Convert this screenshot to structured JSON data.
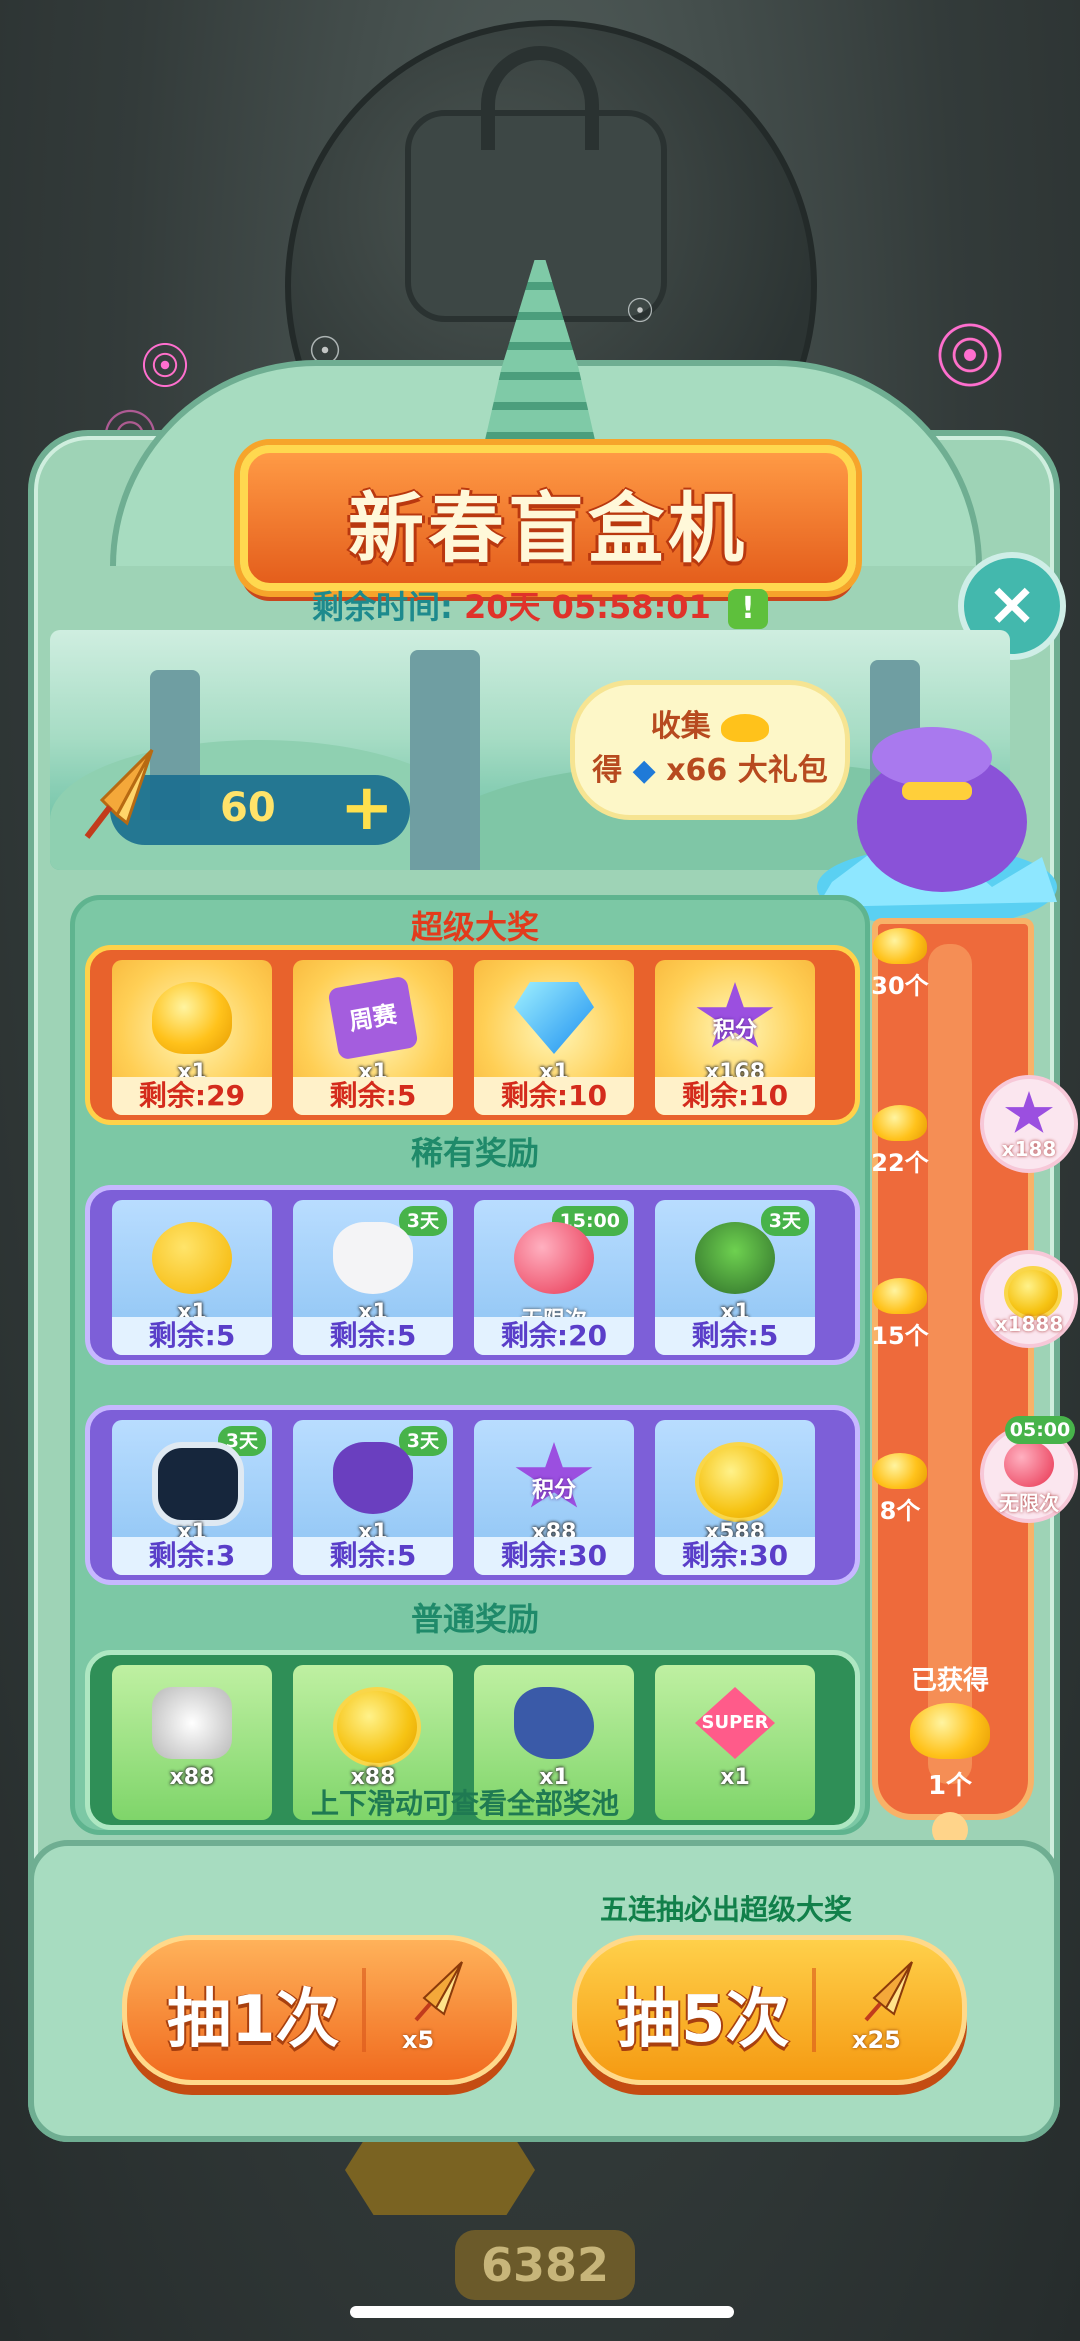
{
  "title": "新春盲盒机",
  "timer": {
    "label": "剩余时间:",
    "value": "20天 05:58:01",
    "alert_icon": "!"
  },
  "tokens": {
    "count": "60",
    "plus": "+"
  },
  "collect": {
    "line1": "收集",
    "line2_prefix": "得",
    "line2_value": "x66",
    "line2_suffix": "大礼包"
  },
  "close_icon": "×",
  "sections": {
    "super": "超级大奖",
    "rare": "稀有奖励",
    "normal": "普通奖励"
  },
  "super_row": [
    {
      "icon": "gold-ingot-icon",
      "qty": "x1",
      "remain": "剩余:29"
    },
    {
      "icon": "weekly-match-ticket-icon",
      "qty": "x1",
      "remain": "剩余:5",
      "label": "周赛"
    },
    {
      "icon": "diamond-icon",
      "qty": "x1",
      "remain": "剩余:10"
    },
    {
      "icon": "score-star-icon",
      "qty": "x168",
      "remain": "剩余:10",
      "label": "积分"
    }
  ],
  "rare_row1": [
    {
      "icon": "golden-egg-icon",
      "qty": "x1",
      "remain": "剩余:5"
    },
    {
      "icon": "rabbit-mask-icon",
      "qty": "x1",
      "remain": "剩余:5",
      "tag": "3天"
    },
    {
      "icon": "balloon-icon",
      "note": "无限次",
      "remain": "剩余:20",
      "tag": "15:00"
    },
    {
      "icon": "frog-mask-icon",
      "qty": "x1",
      "remain": "剩余:5",
      "tag": "3天"
    }
  ],
  "rare_row2": [
    {
      "icon": "goggles-icon",
      "qty": "x1",
      "remain": "剩余:3",
      "tag": "3天"
    },
    {
      "icon": "cat-helmet-icon",
      "qty": "x1",
      "remain": "剩余:5",
      "tag": "3天"
    },
    {
      "icon": "score-star-icon",
      "qty": "x88",
      "remain": "剩余:30",
      "label": "积分"
    },
    {
      "icon": "coin-icon",
      "qty": "x588",
      "remain": "剩余:30"
    }
  ],
  "normal_row": [
    {
      "icon": "silver-badge-icon",
      "qty": "x88"
    },
    {
      "icon": "coin-icon",
      "qty": "x88"
    },
    {
      "icon": "shark-icon",
      "qty": "x1"
    },
    {
      "icon": "super-badge-icon",
      "qty": "x1",
      "label": "SUPER"
    }
  ],
  "scroll_hint": "上下滑动可查看全部奖池",
  "progress": {
    "milestones": [
      "30个",
      "22个",
      "15个",
      "8个"
    ],
    "rewards": [
      {
        "icon": "score-star-icon",
        "qty": "x188",
        "label": "积分"
      },
      {
        "icon": "coin-icon",
        "qty": "x1888"
      },
      {
        "icon": "balloon-icon",
        "qty": "无限次",
        "tag": "05:00"
      }
    ],
    "obtained_label": "已获得",
    "obtained_count": "1个"
  },
  "promo": "五连抽必出超级大奖",
  "buttons": {
    "draw1": {
      "label": "抽1次",
      "cost": "x5"
    },
    "draw5": {
      "label": "抽5次",
      "cost": "x25"
    }
  },
  "background_score": "6382"
}
